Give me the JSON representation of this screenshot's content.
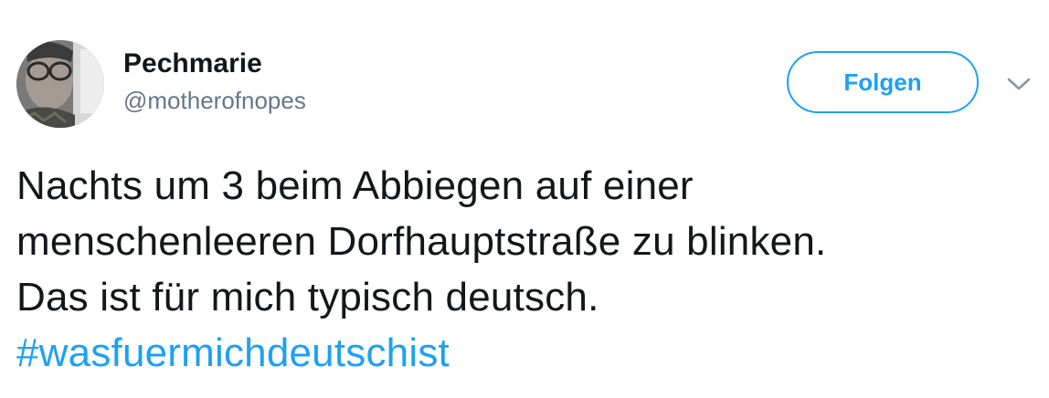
{
  "user": {
    "display_name": "Pechmarie",
    "handle": "@motherofnopes"
  },
  "actions": {
    "follow_label": "Folgen"
  },
  "tweet": {
    "lines": [
      "Nachts um 3 beim Abbiegen auf einer",
      "menschenleeren Dorfhauptstraße zu blinken.",
      "Das ist für mich typisch deutsch."
    ],
    "hashtag": "#wasfuermichdeutschist"
  },
  "icons": {
    "more": "chevron-down-icon"
  },
  "colors": {
    "accent": "#1da1f2",
    "text": "#14171a",
    "secondary_text": "#657786"
  }
}
